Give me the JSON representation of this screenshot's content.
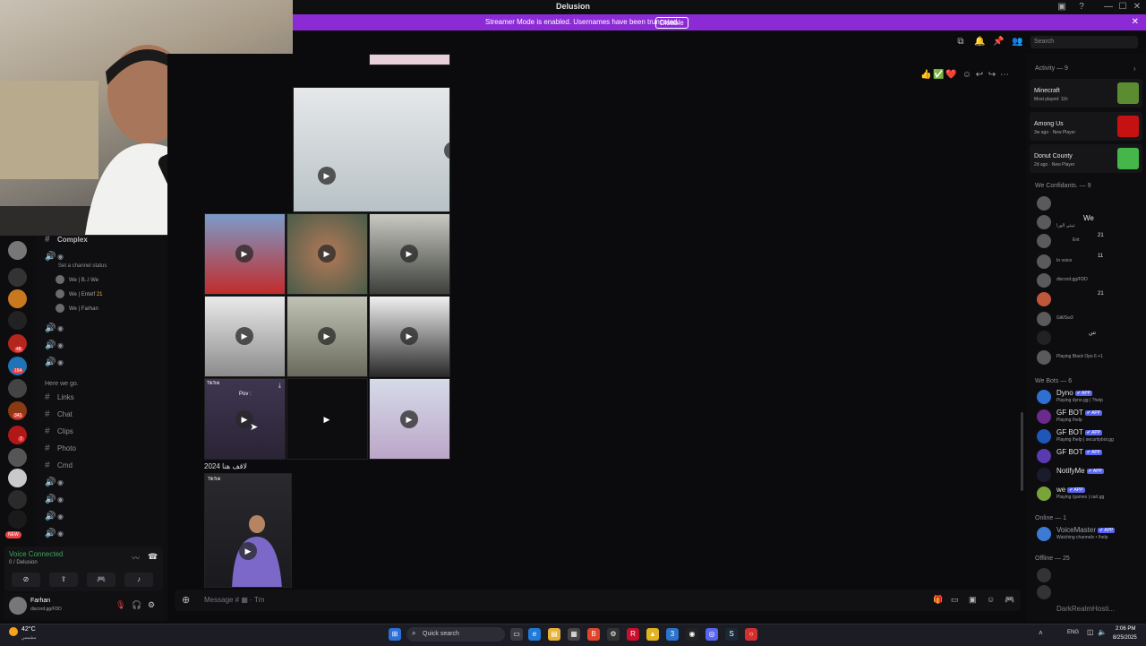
{
  "window": {
    "title": "Delusion",
    "controls": [
      "—",
      "☐",
      "✕"
    ]
  },
  "banner": {
    "message": "Streamer Mode is enabled. Usernames have been truncated.",
    "disable_label": "Disable"
  },
  "header": {
    "search_placeholder": "Search"
  },
  "channels": {
    "category_top": "Complex",
    "channel_status_hint": "Set a channel status",
    "voice_users": [
      {
        "name": "We | B..l",
        "tag": "We"
      },
      {
        "name": "We | Entelf",
        "tag": "21"
      },
      {
        "name": "We | Farhan",
        "tag": ""
      }
    ],
    "category_here": "Here we go.",
    "text_channels": [
      "Links",
      "Chat",
      "Clips",
      "Photo",
      "Cmd"
    ]
  },
  "voice": {
    "status": "Voice Connected",
    "location": "0 / Delusion"
  },
  "user": {
    "name": "Farhan",
    "status": "discord.gg/FDD"
  },
  "server_badges": [
    "48",
    "164",
    "341",
    "7",
    "NEW"
  ],
  "chat": {
    "caption": "2024 لاقف هنا",
    "tiktok_label": "TikTok",
    "pov_text": "Pov :",
    "message_placeholder": "Message #",
    "message_suffix": "Tm",
    "reactions": [
      "👍",
      "✅",
      "❤️"
    ]
  },
  "members": {
    "activity_header": "Activity — 9",
    "activities": [
      {
        "name": "Minecraft",
        "sub": "Most played: 11h",
        "color": "#5b8c32"
      },
      {
        "name": "Among Us",
        "sub": "3w ago · New Player",
        "color": "#c51111"
      },
      {
        "name": "Donut County",
        "sub": "2d ago · New Player",
        "color": "#45b649"
      }
    ],
    "we_header": "We Confidants. — 9",
    "we_members": [
      {
        "name": "",
        "sub": ""
      },
      {
        "name": "We",
        "sub": "تبيتي الورا"
      },
      {
        "name": "21",
        "sub": "Ent"
      },
      {
        "name": "11",
        "sub": "In voice"
      },
      {
        "name": "",
        "sub": "discord.gg/FDD"
      },
      {
        "name": "21",
        "sub": ""
      },
      {
        "name": "",
        "sub": "Gitl/Sw3"
      },
      {
        "name": "تتن",
        "sub": ""
      },
      {
        "name": "",
        "sub": "Playing Black Ops 6 +1"
      }
    ],
    "bots_header": "We Bots — 6",
    "bots": [
      {
        "name": "Dyno",
        "sub": "Playing dyno.gg | ?help"
      },
      {
        "name": "GF BOT",
        "sub": "Playing /help"
      },
      {
        "name": "GF BOT",
        "sub": "Playing /help | securitybot.gg"
      },
      {
        "name": "GF BOT",
        "sub": ""
      },
      {
        "name": "NotifyMe",
        "sub": ""
      },
      {
        "name": "we",
        "sub": "Playing /games | carl.gg"
      }
    ],
    "app_badge": "✔ APP",
    "online_header": "Online — 1",
    "online": [
      {
        "name": "VoiceMaster",
        "sub": "Watching channels • /help"
      }
    ],
    "offline_header": "Offline — 25",
    "offline_last": "DarkRealmHosti..."
  },
  "taskbar": {
    "weather": "42°C",
    "weather_sub": "مشمس",
    "search": "Quick search",
    "lang": "ENG",
    "time": "2:06 PM",
    "date": "8/25/2025"
  },
  "colors": {
    "accent": "#8c2bd6",
    "blurple": "#5865f2",
    "green": "#3ba55d",
    "red": "#ed4245"
  }
}
